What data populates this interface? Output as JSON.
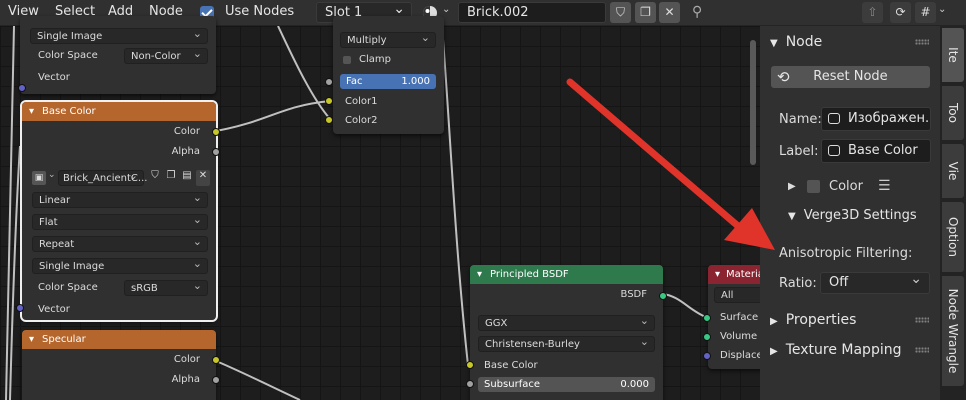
{
  "header": {
    "menus": [
      "View",
      "Select",
      "Add",
      "Node"
    ],
    "use_nodes_label": "Use Nodes",
    "slot": "Slot 1",
    "material_name": "Brick.002"
  },
  "nodes": {
    "top_left": {
      "dd1": "Single Image",
      "colorspace_label": "Color Space",
      "colorspace_value": "Non-Color",
      "vector": "Vector"
    },
    "base_color": {
      "title": "Base Color",
      "out_color": "Color",
      "out_alpha": "Alpha",
      "image_name": "Brick_AncientC...",
      "interpolation": "Linear",
      "projection": "Flat",
      "extension": "Repeat",
      "source": "Single Image",
      "colorspace_label": "Color Space",
      "colorspace_value": "sRGB",
      "vector": "Vector"
    },
    "specular": {
      "title": "Specular",
      "out_color": "Color",
      "out_alpha": "Alpha"
    },
    "mix": {
      "blend": "Multiply",
      "clamp": "Clamp",
      "fac_label": "Fac",
      "fac_value": "1.000",
      "color1": "Color1",
      "color2": "Color2"
    },
    "bsdf": {
      "title": "Principled BSDF",
      "out": "BSDF",
      "distribution": "GGX",
      "subsurface_method": "Christensen-Burley",
      "base_color": "Base Color",
      "subsurface_label": "Subsurface",
      "subsurface_value": "0.000"
    },
    "output": {
      "title": "Material",
      "target": "All",
      "surface": "Surface",
      "volume": "Volume",
      "displacement": "Displacen"
    }
  },
  "sidebar": {
    "node_panel": "Node",
    "reset": "Reset Node",
    "name_label": "Name:",
    "name_value": "Изображен...",
    "label_label": "Label:",
    "label_value": "Base Color",
    "color_sub": "Color",
    "verge_panel": "Verge3D Settings",
    "aniso_label": "Anisotropic Filtering:",
    "ratio_label": "Ratio:",
    "ratio_value": "Off",
    "properties": "Properties",
    "texture_mapping": "Texture Mapping"
  },
  "tabs": [
    "Ite",
    "Too",
    "Vie",
    "Option",
    "Node Wrangle"
  ],
  "colors": {
    "accent": "#4772b3",
    "texture_header": "#b5662d",
    "shader_header": "#2e7a4d",
    "output_header": "#8a2430",
    "arrow": "#e0342b"
  }
}
